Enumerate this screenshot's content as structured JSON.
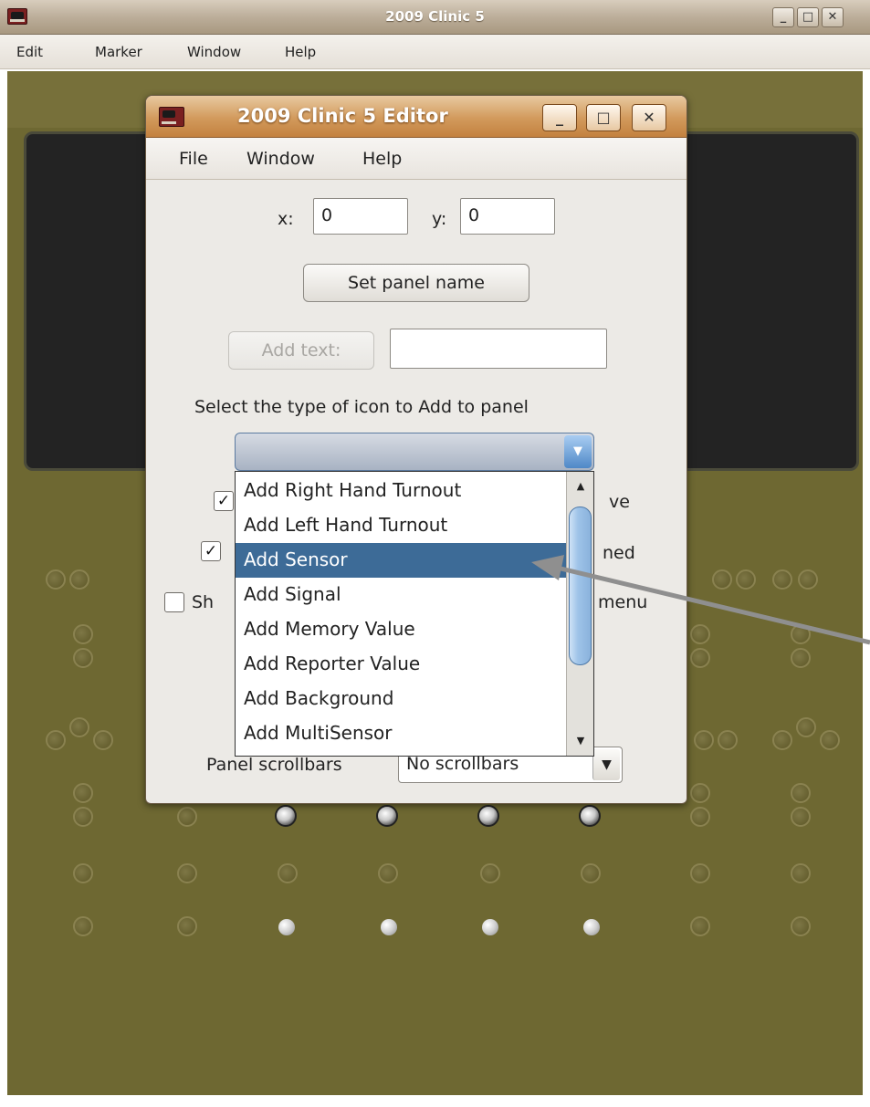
{
  "outer_window": {
    "title": "2009 Clinic 5",
    "menu": [
      "Edit",
      "Marker",
      "Window",
      "Help"
    ],
    "buttons": {
      "minimize": "_",
      "maximize": "□",
      "close": "✕"
    }
  },
  "editor": {
    "title": "2009 Clinic 5 Editor",
    "menu": [
      "File",
      "Window",
      "Help"
    ],
    "buttons": {
      "minimize": "_",
      "maximize": "□",
      "close": "✕"
    },
    "x_label": "x:",
    "x_value": "0",
    "y_label": "y:",
    "y_value": "0",
    "set_panel_name": "Set panel name",
    "add_text": "Add text:",
    "add_text_value": "",
    "icon_type_label": "Select the type of icon to Add to panel",
    "icon_combo_value": "",
    "checkbox_rows": [
      {
        "checked": true,
        "label_fragment": "ve"
      },
      {
        "checked": true,
        "label_fragment": "ned"
      },
      {
        "checked": false,
        "label_prefix": "Sh",
        "label_fragment": "menu"
      }
    ],
    "scrollbars_label": "Panel scrollbars",
    "scrollbars_value": "No scrollbars",
    "dropdown_options": [
      "Add Right Hand Turnout",
      "Add Left Hand Turnout",
      "Add Sensor",
      "Add Signal",
      "Add Memory Value",
      "Add Reporter Value",
      "Add Background",
      "Add MultiSensor"
    ],
    "dropdown_selected": "Add Sensor"
  },
  "colors": {
    "selection": "#3d6b97",
    "panel_background": "#6e6832",
    "editor_titlebar": "#d29a5c"
  },
  "icons": {
    "app": "locomotive-icon",
    "combo_arrow": "chevron-down-icon",
    "scroll_up": "triangle-up-icon",
    "scroll_down": "triangle-down-icon",
    "checkmark": "check-icon"
  }
}
